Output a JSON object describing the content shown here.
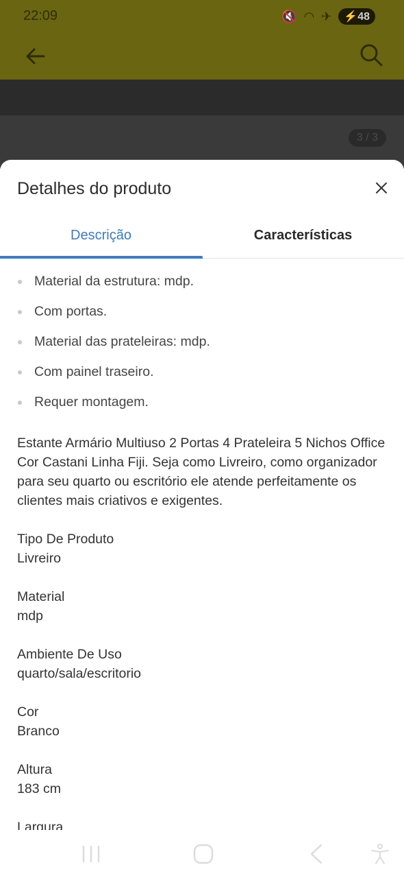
{
  "status_bar": {
    "time": "22:09",
    "battery": "48",
    "colors": {
      "dimmed_header": "#6a6510"
    }
  },
  "header": {
    "back_icon": "arrow-left-icon",
    "search_icon": "search-icon"
  },
  "gallery": {
    "counter": "3 / 3"
  },
  "sheet": {
    "title": "Detalhes do produto",
    "close_icon": "close-icon",
    "tabs": [
      {
        "label": "Descrição",
        "active": true
      },
      {
        "label": "Características",
        "active": false
      }
    ],
    "accent_color": "#3a7bd5",
    "bullets": [
      "Material da estrutura: mdp.",
      "Com portas.",
      "Material das prateleiras: mdp.",
      "Com painel traseiro.",
      "Requer montagem."
    ],
    "description": "Estante Armário Multiuso 2 Portas 4 Prateleira 5 Nichos Office Cor Castani Linha Fiji. Seja como Livreiro, como organizador para seu quarto ou escritório ele atende perfeitamente os clientes mais criativos e exigentes.",
    "specs": [
      {
        "label": "Tipo De Produto",
        "value": "Livreiro"
      },
      {
        "label": "Material",
        "value": "mdp"
      },
      {
        "label": "Ambiente De Uso",
        "value": "quarto/sala/escritorio"
      },
      {
        "label": "Cor",
        "value": "Branco"
      },
      {
        "label": "Altura",
        "value": "183 cm"
      },
      {
        "label": "Largura",
        "value": ""
      }
    ]
  },
  "nav_bar": {
    "icons": [
      "recent-apps-icon",
      "home-icon",
      "back-icon",
      "accessibility-icon"
    ]
  }
}
